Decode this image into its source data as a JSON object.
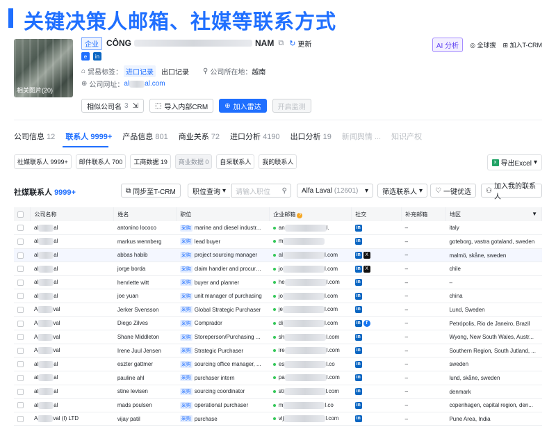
{
  "banner": {
    "title": "关键决策人邮箱、社媒等联系方式"
  },
  "company": {
    "image_caption": "相关图片(20)",
    "type_tag": "企业",
    "name_start": "CÔNG",
    "name_end": "NAM",
    "update": "更新",
    "trade_label": "贸易标签：",
    "import_tag": "进口记录",
    "export_tag": "出口记录",
    "location_label": "公司所在地：",
    "location_value": "越南",
    "website_label": "公司网址：",
    "website_start": "al",
    "website_end": "al.com"
  },
  "topright": {
    "ai": "AI 分析",
    "search": "全球搜",
    "crm": "加入T-CRM"
  },
  "actions": {
    "similar": "相似公司名",
    "similar_count": "3",
    "import_crm": "导入内部CRM",
    "add_radar": "加入雷达",
    "monitor": "开启监测"
  },
  "tabs": [
    {
      "label": "公司信息",
      "num": "12"
    },
    {
      "label": "联系人",
      "num": "9999+"
    },
    {
      "label": "产品信息",
      "num": "801"
    },
    {
      "label": "商业关系",
      "num": "72"
    },
    {
      "label": "进口分析",
      "num": "4190"
    },
    {
      "label": "出口分析",
      "num": "19"
    },
    {
      "label": "新闻舆情 ...",
      "num": ""
    },
    {
      "label": "知识产权",
      "num": ""
    }
  ],
  "subtabs": [
    "社媒联系人 9999+",
    "邮件联系人 700",
    "工商数据 19",
    "商业数据 0",
    "自采联系人",
    "我的联系人"
  ],
  "export_excel": "导出Excel",
  "toolbar": {
    "title": "社媒联系人",
    "count": "9999+",
    "sync": "同步至T-CRM",
    "position_query": "职位查询",
    "position_placeholder": "请输入职位",
    "company_filter": "Alfa Laval",
    "company_count": "(12601)",
    "filter_contacts": "筛选联系人",
    "one_click": "一键优选",
    "add_mine": "加入我的联系人"
  },
  "table": {
    "headers": [
      "公司名称",
      "姓名",
      "职位",
      "企业邮箱",
      "社交",
      "补充邮箱",
      "地区"
    ],
    "badge": "采购",
    "rows": [
      {
        "company": "al",
        "company_end": "al",
        "name": "antonino lococo",
        "position": "marine and diesel industr...",
        "email_start": "an",
        "email_end": "l.",
        "social": [
          "in"
        ],
        "extra": "–",
        "region": "italy"
      },
      {
        "company": "al",
        "company_end": "al",
        "name": "markus wennberg",
        "position": "lead buyer",
        "email_start": "m",
        "email_end": "",
        "social": [
          "in"
        ],
        "extra": "–",
        "region": "goteborg, vastra gotaland, sweden"
      },
      {
        "company": "al",
        "company_end": "al",
        "name": "abbas habib",
        "position": "project sourcing manager",
        "email_start": "al",
        "email_end": "l.com",
        "social": [
          "in",
          "x"
        ],
        "extra": "–",
        "region": "malmö, skåne, sweden"
      },
      {
        "company": "al",
        "company_end": "al",
        "name": "jorge borda",
        "position": "claim handler and procure...",
        "email_start": "jo",
        "email_end": "l.com",
        "social": [
          "in",
          "x"
        ],
        "extra": "–",
        "region": "chile"
      },
      {
        "company": "al",
        "company_end": "al",
        "name": "henriette witt",
        "position": "buyer and planner",
        "email_start": "he",
        "email_end": "l.com",
        "social": [
          "in"
        ],
        "extra": "–",
        "region": "–"
      },
      {
        "company": "al",
        "company_end": "al",
        "name": "joe yuan",
        "position": "unit manager of purchasing",
        "email_start": "jo",
        "email_end": "l.com",
        "social": [
          "in"
        ],
        "extra": "–",
        "region": "china"
      },
      {
        "company": "A",
        "company_end": "val",
        "name": "Jerker Svensson",
        "position": "Global Strategic Purchaser",
        "email_start": "je",
        "email_end": "l.com",
        "social": [
          "in"
        ],
        "extra": "–",
        "region": "Lund, Sweden"
      },
      {
        "company": "A",
        "company_end": "val",
        "name": "Diego Zilves",
        "position": "Comprador",
        "email_start": "di",
        "email_end": "l.com",
        "social": [
          "in",
          "fb"
        ],
        "extra": "–",
        "region": "Petrópolis, Rio de Janeiro, Brazil"
      },
      {
        "company": "A",
        "company_end": "val",
        "name": "Shane Middleton",
        "position": "Storeperson/Purchasing ...",
        "email_start": "sh",
        "email_end": "l.com",
        "social": [
          "in"
        ],
        "extra": "–",
        "region": "Wyong, New South Wales, Austr..."
      },
      {
        "company": "A",
        "company_end": "val",
        "name": "Irene Juul Jensen",
        "position": "Strategic Purchaser",
        "email_start": "ire",
        "email_end": "l.com",
        "social": [
          "in"
        ],
        "extra": "–",
        "region": "Southern Region, South Jutland, ..."
      },
      {
        "company": "al",
        "company_end": "al",
        "name": "eszter gattmer",
        "position": "sourcing office manager, ...",
        "email_start": "es",
        "email_end": "l.co",
        "social": [
          "in"
        ],
        "extra": "–",
        "region": "sweden"
      },
      {
        "company": "al",
        "company_end": "al",
        "name": "pauline ahl",
        "position": "purchaser intern",
        "email_start": "pa",
        "email_end": "l.com",
        "social": [
          "in"
        ],
        "extra": "–",
        "region": "lund, skåne, sweden"
      },
      {
        "company": "al",
        "company_end": "al",
        "name": "stine levisen",
        "position": "sourcing coordinator",
        "email_start": "sti",
        "email_end": "l.com",
        "social": [
          "in"
        ],
        "extra": "–",
        "region": "denmark"
      },
      {
        "company": "al",
        "company_end": "al",
        "name": "mads poulsen",
        "position": "operational purchaser",
        "email_start": "m",
        "email_end": "l.co",
        "social": [
          "in"
        ],
        "extra": "–",
        "region": "copenhagen, capital region, den..."
      },
      {
        "company": "A",
        "company_end": "val (I) LTD",
        "name": "vijay patil",
        "position": "purchase",
        "email_start": "vij",
        "email_end": "l.com",
        "social": [
          "in"
        ],
        "extra": "–",
        "region": "Pune Area, India"
      }
    ]
  }
}
